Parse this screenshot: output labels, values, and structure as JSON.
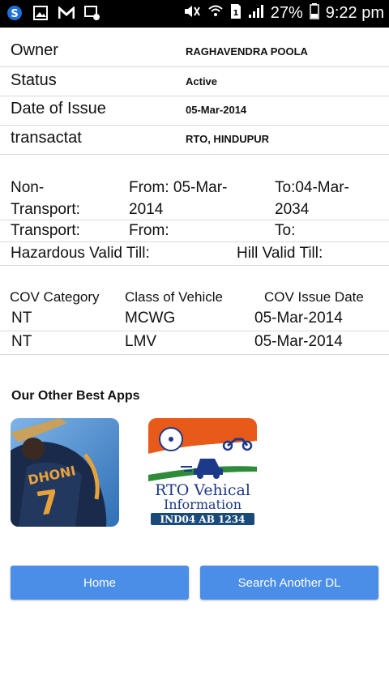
{
  "status_bar": {
    "battery": "27%",
    "time": "9:22 pm",
    "icons": [
      "s-app-icon",
      "gallery-icon",
      "gmail-icon",
      "wifi-settings-icon",
      "mute-icon",
      "wifi-icon",
      "sim-icon",
      "signal-icon",
      "battery-icon"
    ]
  },
  "details": [
    {
      "label": "Owner",
      "value": "RAGHAVENDRA POOLA"
    },
    {
      "label": "Status",
      "value": "Active"
    },
    {
      "label": "Date of Issue",
      "value": "05-Mar-2014"
    },
    {
      "label": "transactat",
      "value": "RTO, HINDUPUR"
    }
  ],
  "validity": {
    "non_transport_label_1": "Non-",
    "non_transport_label_2": "Transport:",
    "non_transport_from_1": "From: 05-Mar-",
    "non_transport_from_2": "2014",
    "non_transport_to_1": "To:04-Mar-",
    "non_transport_to_2": "2034",
    "transport_label": "Transport:",
    "transport_from": "From:",
    "transport_to": "To:",
    "hazardous": "Hazardous Valid Till:",
    "hill": "Hill Valid Till:"
  },
  "cov": {
    "headers": [
      "COV Category",
      "Class of Vehicle",
      "COV Issue Date"
    ],
    "rows": [
      [
        "NT",
        "MCWG",
        "05-Mar-2014"
      ],
      [
        "NT",
        "LMV",
        "05-Mar-2014"
      ]
    ]
  },
  "other_apps": {
    "title": "Our Other Best Apps",
    "dhoni_text": "DHONI",
    "dhoni_number": "7",
    "rto_line1": "RTO Vehical",
    "rto_line2": "Information",
    "rto_plate": "IND04 AB 1234"
  },
  "buttons": {
    "home": "Home",
    "search": "Search Another DL"
  },
  "colors": {
    "button": "#4a8ee8",
    "status_bar": "#000000",
    "divider": "#d9d9d9"
  }
}
